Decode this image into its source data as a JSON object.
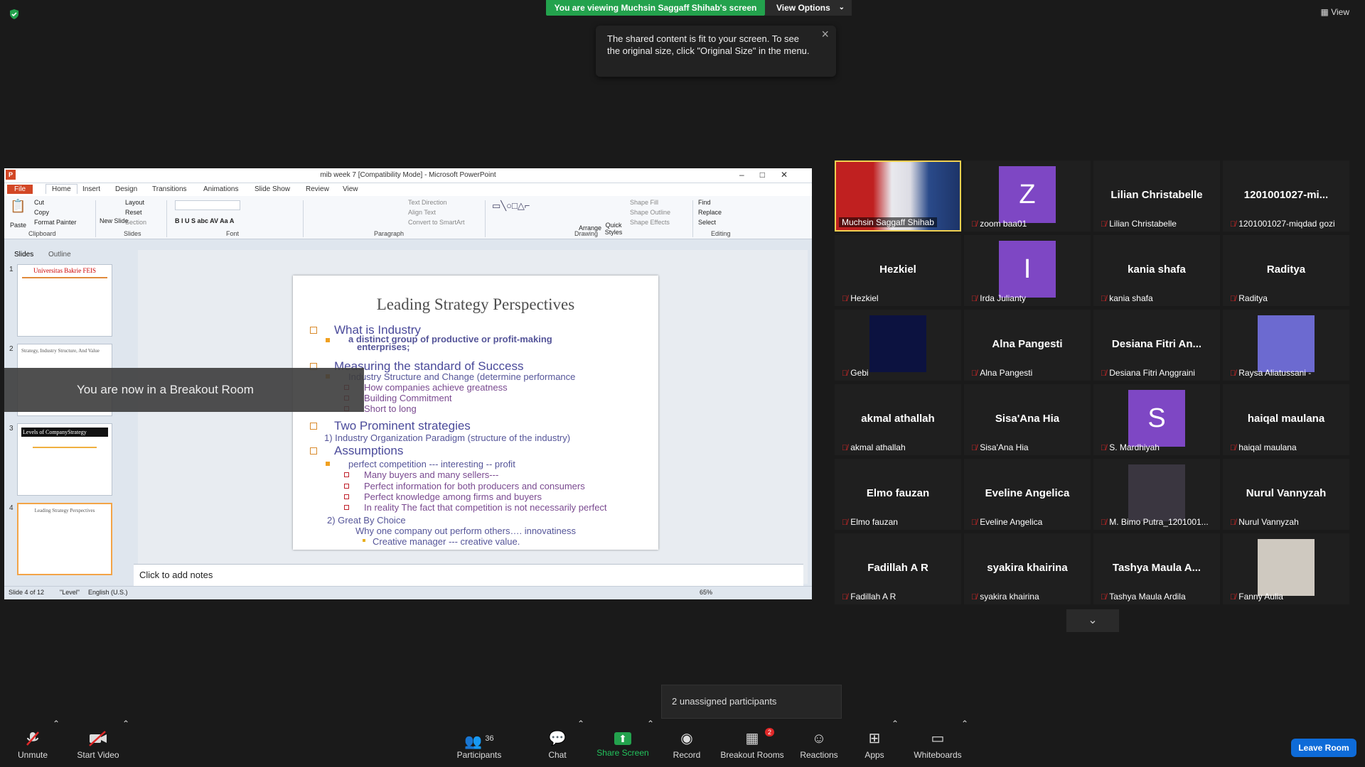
{
  "banner": {
    "viewing": "You are viewing Muchsin Saggaff Shihab's screen",
    "view_options": "View Options",
    "view": "View"
  },
  "tooltip": {
    "text": "The shared content is fit to your screen. To see the original size, click \"Original Size\" in the menu."
  },
  "breakout_toast": "You are now in a Breakout Room",
  "ppt": {
    "title": "mib week 7 [Compatibility Mode] - Microsoft PowerPoint",
    "tabs": [
      "File",
      "Home",
      "Insert",
      "Design",
      "Transitions",
      "Animations",
      "Slide Show",
      "Review",
      "View"
    ],
    "groups": [
      "Clipboard",
      "Slides",
      "Font",
      "Paragraph",
      "Drawing",
      "Editing"
    ],
    "clipboard": {
      "paste": "Paste",
      "cut": "Cut",
      "copy": "Copy",
      "format_painter": "Format Painter"
    },
    "slides_grp": {
      "new_slide": "New Slide",
      "layout": "Layout",
      "reset": "Reset",
      "section": "Section"
    },
    "paragraph": {
      "text_direction": "Text Direction",
      "align_text": "Align Text",
      "convert": "Convert to SmartArt"
    },
    "drawing": {
      "arrange": "Arrange",
      "quick_styles": "Quick Styles",
      "shape_fill": "Shape Fill",
      "shape_outline": "Shape Outline",
      "shape_effects": "Shape Effects"
    },
    "editing": {
      "find": "Find",
      "replace": "Replace",
      "select": "Select"
    },
    "panel_tabs": [
      "Slides",
      "Outline"
    ],
    "thumbs": [
      {
        "num": "1",
        "title": "Universitas Bakrie FEIS"
      },
      {
        "num": "2",
        "title": "Strategy, Industry Structure, And Value"
      },
      {
        "num": "3",
        "title": "Levels of CompanyStrategy"
      },
      {
        "num": "4",
        "title": "Leading Strategy Perspectives"
      }
    ],
    "notes": "Click to add notes",
    "status": {
      "slide": "Slide 4 of 12",
      "theme": "\"Level\"",
      "lang": "English (U.S.)",
      "zoom": "65%"
    }
  },
  "slide": {
    "title": "Leading Strategy Perspectives",
    "lines": [
      "What is Industry",
      "a distinct group of productive or profit-making",
      "enterprises;",
      "Measuring the standard of Success",
      "Industry Structure and Change (determine performance",
      "How companies achieve greatness",
      "Building Commitment",
      "Short to long",
      "Two Prominent strategies",
      "1) Industry Organization Paradigm (structure of the industry)",
      "Assumptions",
      "perfect competition --- interesting -- profit",
      "Many buyers and many sellers---",
      "Perfect information for both producers and consumers",
      "Perfect knowledge among firms and buyers",
      "In reality The fact that competition is not necessarily perfect",
      "2) Great By Choice",
      "Why one company out perform others…. innovatiness",
      "Creative manager --- creative value."
    ]
  },
  "participants": [
    {
      "name": "Muchsin Saggaff Shihab",
      "display": "",
      "avatar": "photo",
      "muted": false
    },
    {
      "name": "zoom baa01",
      "display": "",
      "avatar": "Z",
      "muted": true
    },
    {
      "name": "Lilian Christabelle",
      "display": "Lilian Christabelle",
      "avatar": "",
      "muted": true
    },
    {
      "name": "1201001027-miqdad gozi",
      "display": "1201001027-mi...",
      "avatar": "",
      "muted": true
    },
    {
      "name": "Hezkiel",
      "display": "Hezkiel",
      "avatar": "",
      "muted": true
    },
    {
      "name": "Irda Julianty",
      "display": "",
      "avatar": "I",
      "muted": true
    },
    {
      "name": "kania shafa",
      "display": "kania shafa",
      "avatar": "",
      "muted": true
    },
    {
      "name": "Raditya",
      "display": "Raditya",
      "avatar": "",
      "muted": true
    },
    {
      "name": "Gebi",
      "display": "",
      "avatar": "photo",
      "muted": true
    },
    {
      "name": "Alna Pangesti",
      "display": "Alna Pangesti",
      "avatar": "",
      "muted": true
    },
    {
      "name": "Desiana Fitri Anggraini",
      "display": "Desiana Fitri An...",
      "avatar": "",
      "muted": true
    },
    {
      "name": "Raysa Aliatussani -",
      "display": "",
      "avatar": "photo",
      "muted": true
    },
    {
      "name": "akmal athallah",
      "display": "akmal athallah",
      "avatar": "",
      "muted": true
    },
    {
      "name": "Sisa'Ana Hia",
      "display": "Sisa'Ana Hia",
      "avatar": "",
      "muted": true
    },
    {
      "name": "S. Mardhiyah",
      "display": "",
      "avatar": "S",
      "muted": true
    },
    {
      "name": "haiqal maulana",
      "display": "haiqal maulana",
      "avatar": "",
      "muted": true
    },
    {
      "name": "Elmo fauzan",
      "display": "Elmo fauzan",
      "avatar": "",
      "muted": true
    },
    {
      "name": "Eveline Angelica",
      "display": "Eveline Angelica",
      "avatar": "",
      "muted": true
    },
    {
      "name": "M. Bimo Putra_1201001...",
      "display": "",
      "avatar": "photo",
      "muted": true
    },
    {
      "name": "Nurul Vannyzah",
      "display": "Nurul Vannyzah",
      "avatar": "",
      "muted": true
    },
    {
      "name": "Fadillah A R",
      "display": "Fadillah A R",
      "avatar": "",
      "muted": true
    },
    {
      "name": "syakira khairina",
      "display": "syakira khairina",
      "avatar": "",
      "muted": true
    },
    {
      "name": "Tashya Maula Ardila",
      "display": "Tashya Maula A...",
      "avatar": "",
      "muted": true
    },
    {
      "name": "Fanny Aulia",
      "display": "",
      "avatar": "photo",
      "muted": true
    }
  ],
  "unassigned": "2 unassigned participants",
  "toolbar": {
    "unmute": "Unmute",
    "start_video": "Start Video",
    "participants": "Participants",
    "participants_count": "36",
    "chat": "Chat",
    "share": "Share Screen",
    "record": "Record",
    "breakout": "Breakout Rooms",
    "breakout_badge": "2",
    "reactions": "Reactions",
    "apps": "Apps",
    "whiteboards": "Whiteboards",
    "leave": "Leave Room"
  },
  "colors": {
    "share_green": "#23a24d",
    "leave_blue": "#0e6bd8",
    "avatar_purple": "#7e47c4",
    "muted_red": "#e02828"
  }
}
